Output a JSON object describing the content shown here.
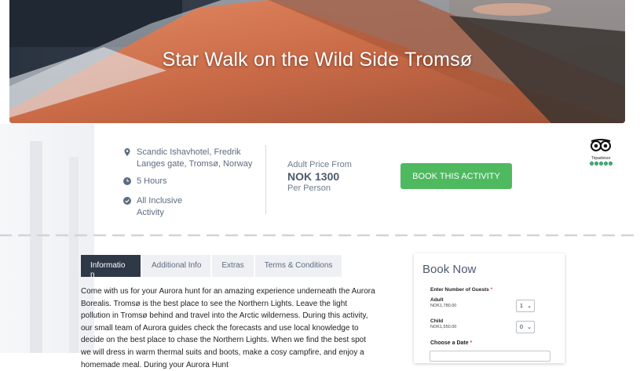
{
  "hero": {
    "title": "Star Walk on the Wild Side Tromsø"
  },
  "info": {
    "location_line1": "Scandic Ishavhotel, Fredrik",
    "location_line2": "Langes gate, Tromsø, Norway",
    "duration": "5 Hours",
    "inclusive_line1": "All Inclusive",
    "inclusive_line2": "Activity"
  },
  "price": {
    "label": "Adult Price From",
    "value": "NOK 1300",
    "sub": "Per Person"
  },
  "book_button": "BOOK THIS ACTIVITY",
  "tripadvisor": {
    "label": "Tripadvisor",
    "rating": 5
  },
  "tabs": [
    {
      "label": "Informatio n"
    },
    {
      "label": "Additional Info"
    },
    {
      "label": "Extras"
    },
    {
      "label": "Terms & Conditions"
    }
  ],
  "description": "Come with us for your Aurora hunt for an amazing experience underneath the Aurora Borealis. Tromsø is the best place to see the Northern Lights. Leave the light pollution in Tromsø behind and travel into the Arctic wilderness. During this activity, our small team of Aurora guides check the forecasts and use local knowledge to decide on the best place to chase the Northern Lights. When we find the best spot we will dress in warm thermal suits and boots, make a cosy campfire, and enjoy a homemade meal. During your Aurora Hunt",
  "booking": {
    "title": "Book Now",
    "guests_label": "Enter Number of Guests",
    "required_mark": "*",
    "adult_label": "Adult",
    "adult_price": "NOK1,780.00",
    "adult_count": "1",
    "child_label": "Child",
    "child_price": "NOK1,550.00",
    "child_count": "0",
    "date_label": "Choose a Date"
  },
  "colors": {
    "accent": "#4fb960",
    "dark": "#2e3847",
    "required": "#d9534f"
  }
}
